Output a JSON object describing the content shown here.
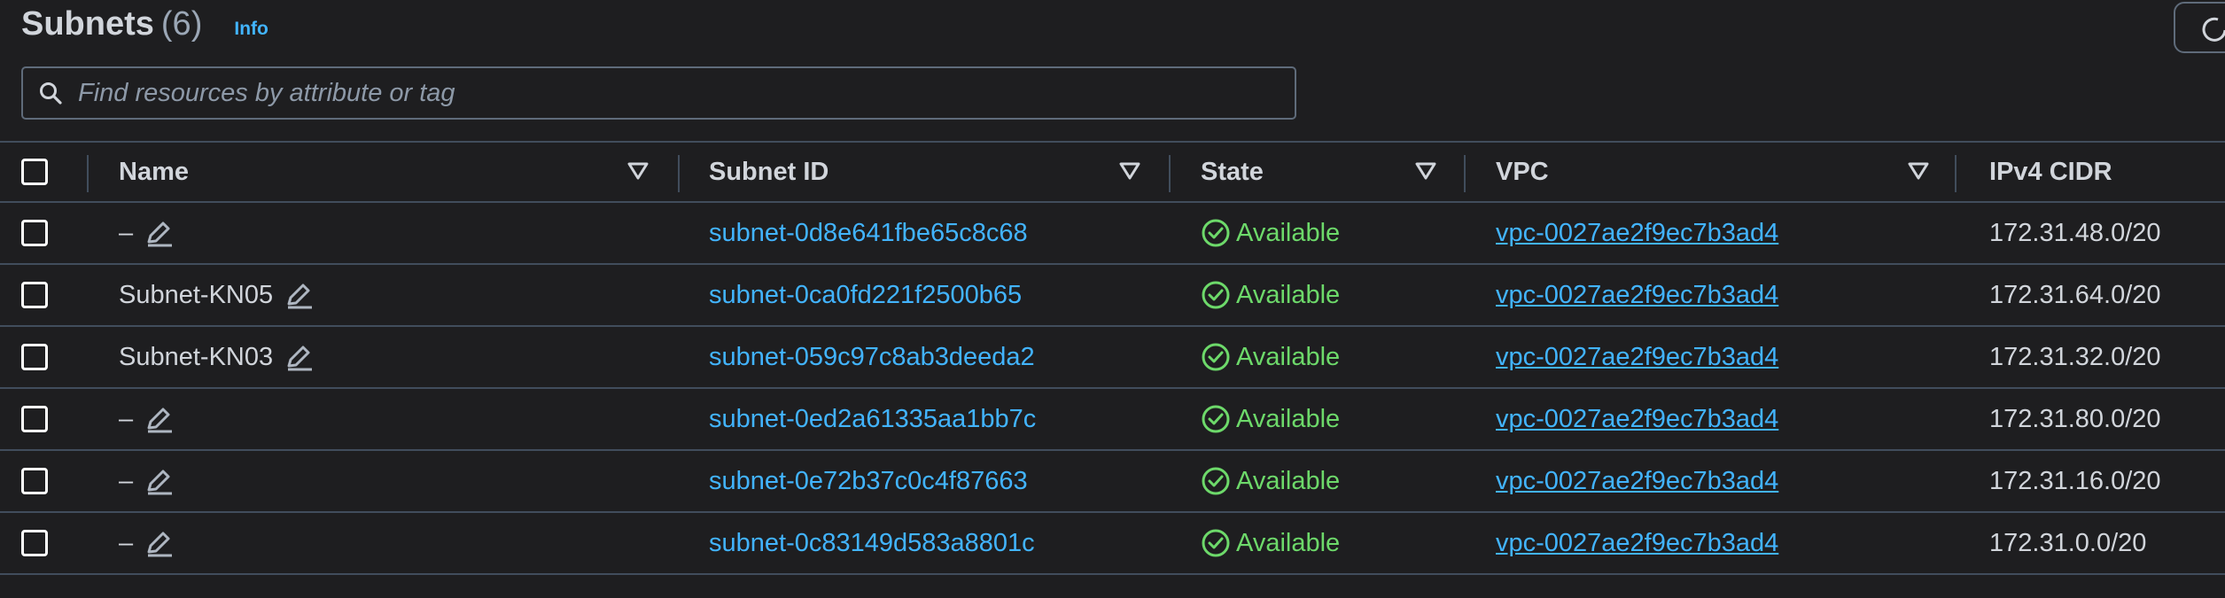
{
  "header": {
    "title": "Subnets",
    "count": "(6)",
    "info": "Info"
  },
  "search": {
    "placeholder": "Find resources by attribute or tag",
    "value": ""
  },
  "table": {
    "columns": {
      "name": "Name",
      "subnet_id": "Subnet ID",
      "state": "State",
      "vpc": "VPC",
      "ipv4_cidr": "IPv4 CIDR"
    },
    "rows": [
      {
        "name": "–",
        "subnet_id": "subnet-0d8e641fbe65c8c68",
        "state": "Available",
        "vpc": "vpc-0027ae2f9ec7b3ad4",
        "cidr": "172.31.48.0/20"
      },
      {
        "name": "Subnet-KN05",
        "subnet_id": "subnet-0ca0fd221f2500b65",
        "state": "Available",
        "vpc": "vpc-0027ae2f9ec7b3ad4",
        "cidr": "172.31.64.0/20"
      },
      {
        "name": "Subnet-KN03",
        "subnet_id": "subnet-059c97c8ab3deeda2",
        "state": "Available",
        "vpc": "vpc-0027ae2f9ec7b3ad4",
        "cidr": "172.31.32.0/20"
      },
      {
        "name": "–",
        "subnet_id": "subnet-0ed2a61335aa1bb7c",
        "state": "Available",
        "vpc": "vpc-0027ae2f9ec7b3ad4",
        "cidr": "172.31.80.0/20"
      },
      {
        "name": "–",
        "subnet_id": "subnet-0e72b37c0c4f87663",
        "state": "Available",
        "vpc": "vpc-0027ae2f9ec7b3ad4",
        "cidr": "172.31.16.0/20"
      },
      {
        "name": "–",
        "subnet_id": "subnet-0c83149d583a8801c",
        "state": "Available",
        "vpc": "vpc-0027ae2f9ec7b3ad4",
        "cidr": "172.31.0.0/20"
      }
    ]
  },
  "icons": {
    "search": "search-icon",
    "filter": "filter-triangle-icon",
    "edit": "pencil-icon",
    "status": "check-circle-icon"
  },
  "colors": {
    "background": "#1e1e20",
    "link": "#42b4ff",
    "success": "#6dd96a",
    "border": "#414d5c"
  }
}
